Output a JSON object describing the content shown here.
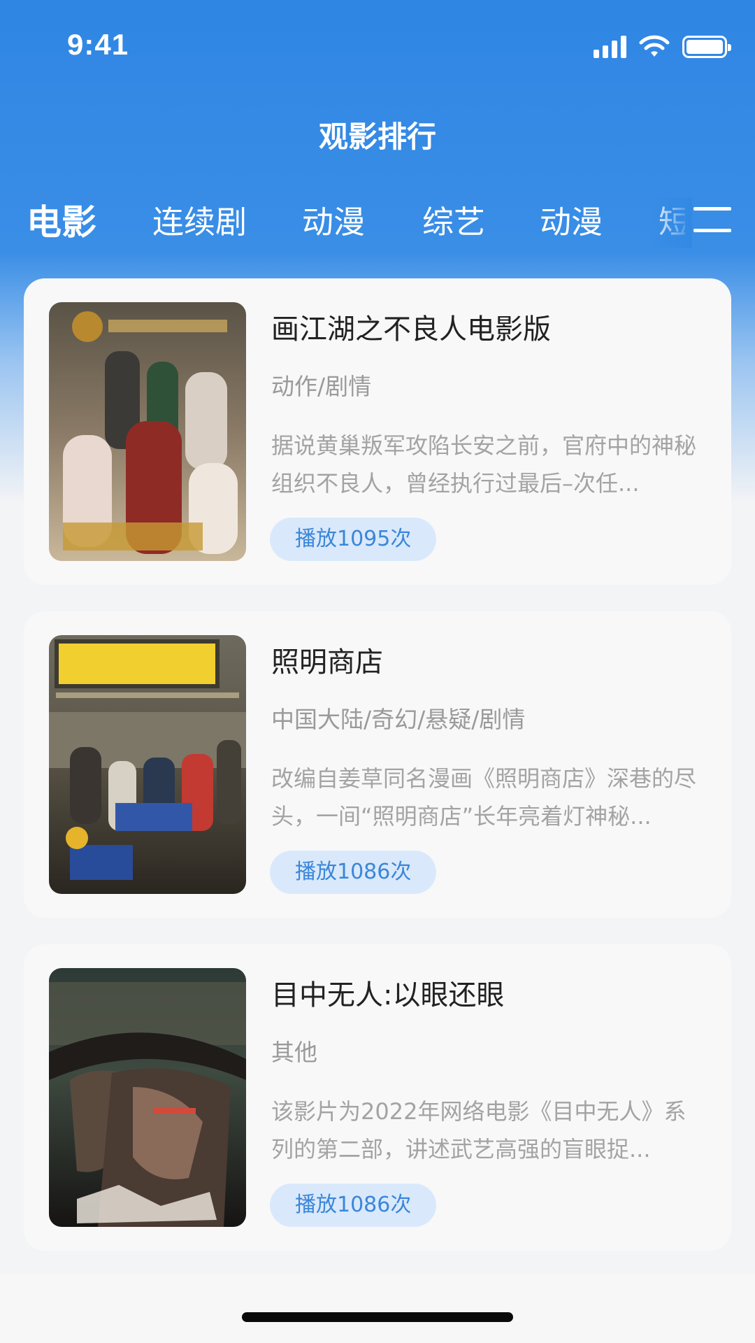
{
  "status_bar": {
    "time": "9:41"
  },
  "header": {
    "title": "观影排行"
  },
  "tabs": [
    {
      "label": "电影",
      "active": true
    },
    {
      "label": "连续剧",
      "active": false
    },
    {
      "label": "动漫",
      "active": false
    },
    {
      "label": "综艺",
      "active": false
    },
    {
      "label": "动漫",
      "active": false
    },
    {
      "label": "短",
      "active": false
    }
  ],
  "movies": [
    {
      "title": "画江湖之不良人电影版",
      "genre": "动作/剧情",
      "description": "据说黄巢叛军攻陷长安之前，官府中的神秘组织不良人，曾经执行过最后–次任...",
      "plays": "播放1095次",
      "poster_icon": "movie-poster-1"
    },
    {
      "title": "照明商店",
      "genre": "中国大陆/奇幻/悬疑/剧情",
      "description": "改编自姜草同名漫画《照明商店》深巷的尽头，一间“照明商店”长年亮着灯神秘...",
      "plays": "播放1086次",
      "poster_icon": "movie-poster-2"
    },
    {
      "title": "目中无人:以眼还眼",
      "genre": "其他",
      "description": "该影片为2022年网络电影《目中无人》系列的第二部，讲述武艺高强的盲眼捉...",
      "plays": "播放1086次",
      "poster_icon": "movie-poster-3"
    }
  ],
  "colors": {
    "header_blue": "#2f86e3",
    "badge_bg": "#d9e9fb",
    "badge_text": "#3b86d9"
  }
}
